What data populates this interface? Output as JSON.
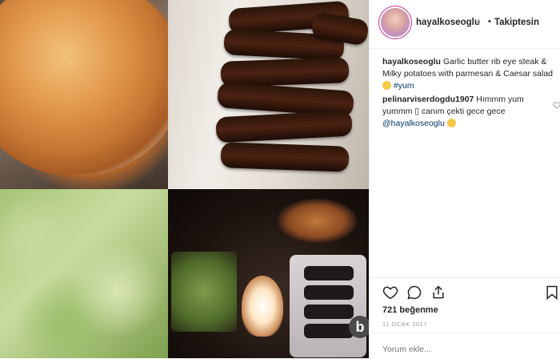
{
  "post": {
    "username": "hayalkoseoglu",
    "verified_mark": "⬧",
    "separator": "•",
    "follow_label": "Takiptesin"
  },
  "caption": {
    "user": "hayalkoseoglu",
    "text": " Garlic butter rib eye steak & Milky potatoes with parmesan & Caesar salad ",
    "hashtag": "#yum"
  },
  "comment": {
    "user": "pelinarviserdogdu1907",
    "text": " Hımmm yum yummm ▯ canım çekti gece gece ",
    "mention": "@hayalkoseoglu"
  },
  "likes": "721 beğenme",
  "date": "11 OCAK 2017",
  "add_comment": {
    "placeholder": "Yorum ekle..."
  },
  "icons": {
    "like": "heart-icon",
    "comment": "comment-icon",
    "share": "share-icon",
    "save": "bookmark-icon",
    "comment_like": "heart-icon"
  },
  "colors": {
    "text": "#262626",
    "link": "#003569",
    "muted": "#999999",
    "story_ring": "#c8338f"
  },
  "watermark": "b"
}
